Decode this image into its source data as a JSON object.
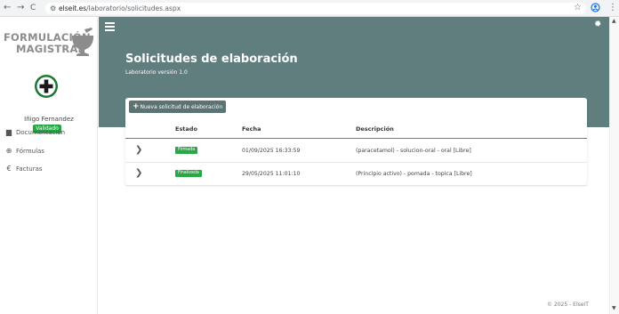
{
  "browser": {
    "back": "←",
    "forward": "→",
    "reload": "C",
    "url_host": "elseit.es",
    "url_path": "/laboratorio/solicitudes.aspx",
    "star": "☆",
    "menu": "⋮"
  },
  "sidebar": {
    "logo_line1": "FORMULACIÓN",
    "logo_line2": "MAGISTRAL",
    "user_name": "Iñigo Fernandez",
    "user_status": "Validado",
    "menu": [
      {
        "label": "Documentación",
        "icon": "book-icon",
        "glyph": "▆"
      },
      {
        "label": "Fórmulas",
        "icon": "globe-icon",
        "glyph": "⊕"
      },
      {
        "label": "Facturas",
        "icon": "euro-icon",
        "glyph": "€"
      }
    ]
  },
  "header": {
    "title": "Solicitudes de elaboración",
    "subtitle": "Laboratorio versión 1.0"
  },
  "actions": {
    "new_request": "Nueva solicitud de elaboración"
  },
  "table": {
    "columns": [
      "Estado",
      "Fecha",
      "Descripción"
    ],
    "rows": [
      {
        "estado": "Firmada",
        "fecha": "01/09/2025 16:33:59",
        "descripcion": "(paracetamol) - solucion-oral - oral [Libre]"
      },
      {
        "estado": "Finalizada",
        "fecha": "29/05/2025 11:01:10",
        "descripcion": "(Principio activo) - pomada - topica [Libre]"
      }
    ]
  },
  "footer": {
    "copyright": "© 2025 - ElseIT"
  },
  "colors": {
    "header_band": "#617e7f",
    "button": "#5c7374",
    "status_green": "#28a745"
  }
}
